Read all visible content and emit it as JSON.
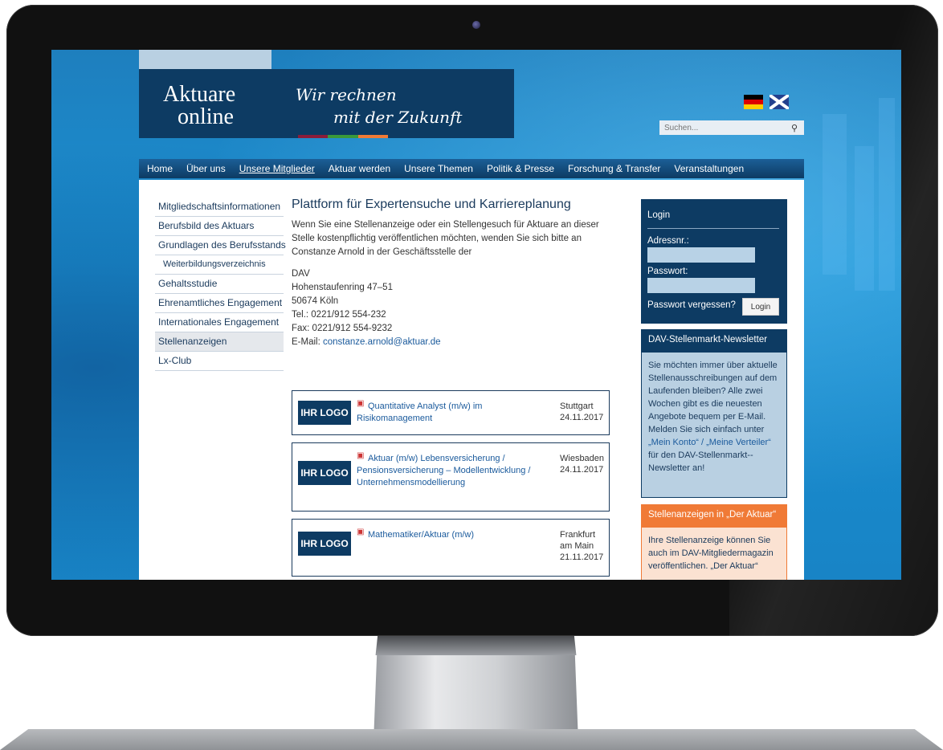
{
  "site": {
    "logo_line1": "Aktuare",
    "logo_line2": "online",
    "slogan_line1": "Wir rechnen",
    "slogan_line2": "mit der Zukunft",
    "stripe_colors": [
      "#8a1c3a",
      "#3a9a3a",
      "#f07a36"
    ]
  },
  "search": {
    "placeholder": "Suchen..."
  },
  "nav": {
    "items": [
      "Home",
      "Über uns",
      "Unsere Mitglieder",
      "Aktuar werden",
      "Unsere Themen",
      "Politik & Presse",
      "Forschung & Transfer",
      "Veranstaltungen"
    ],
    "active": "Unsere Mitglieder"
  },
  "left_menu": [
    "Mitgliedschaftsinformationen",
    "Berufsbild des Aktuars",
    "Grundlagen des Berufsstands",
    "Weiterbildungsverzeichnis",
    "Gehaltsstudie",
    "Ehrenamtliches Engagement",
    "Internationales Engagement",
    "Stellenanzeigen",
    "Lx-Club"
  ],
  "main": {
    "title": "Plattform für Expertensuche und Karriereplanung",
    "intro": "Wenn Sie eine Stellenanzeige oder ein Stellengesuch für Aktuare an dieser Stelle kostenpflichtig veröffentlichen möchten, wenden Sie sich bitte an Constanze Arnold in der Geschäftsstelle der",
    "address": [
      "DAV",
      "Hohenstaufenring 47–51",
      "50674 Köln",
      "Tel.: 0221/912 554-232",
      "Fax: 0221/912 554-9232"
    ],
    "email_label": "E-Mail: ",
    "email": "constanze.arnold@aktuar.de"
  },
  "jobs": [
    {
      "logo": "IHR LOGO",
      "title": "Quantitative Analyst (m/w) im Risikomanagement",
      "location": "Stuttgart",
      "date": "24.11.2017"
    },
    {
      "logo": "IHR LOGO",
      "title": "Aktuar (m/w) Lebensversicherung / Pensionsversicherung – Modellentwicklung / Unternehmensmodellierung",
      "location": "Wiesbaden",
      "date": "24.11.2017"
    },
    {
      "logo": "IHR LOGO",
      "title": "Mathematiker/Aktuar (m/w)",
      "location": "Frankfurt am Main",
      "date": "21.11.2017"
    }
  ],
  "login": {
    "title": "Login",
    "user_label": "Adressnr.:",
    "password_label": "Passwort:",
    "forgot": "Passwort vergessen?",
    "button": "Login"
  },
  "newsletter": {
    "title": "DAV-Stellenmarkt-Newsletter",
    "body_before": "Sie möchten immer über aktuelle Stellenausschreibungen auf dem Laufenden bleiben? Alle zwei Wochen gibt es die neuesten Angebote bequem per E-Mail. Melden Sie sich einfach unter ",
    "link": "„Mein Konto“ / „Meine Verteiler“",
    "body_after": " für den DAV-Stellenmarkt--Newsletter an!"
  },
  "aktuar_box": {
    "title": "Stellenanzeigen in „Der Aktuar“",
    "body": "Ihre Stellenanzeige können Sie auch im DAV-Mitgliedermagazin veröffentlichen. „Der Aktuar“"
  },
  "colors": {
    "navy": "#0d3b63",
    "accent_orange": "#f07a36",
    "sky": "#1a90d2"
  }
}
